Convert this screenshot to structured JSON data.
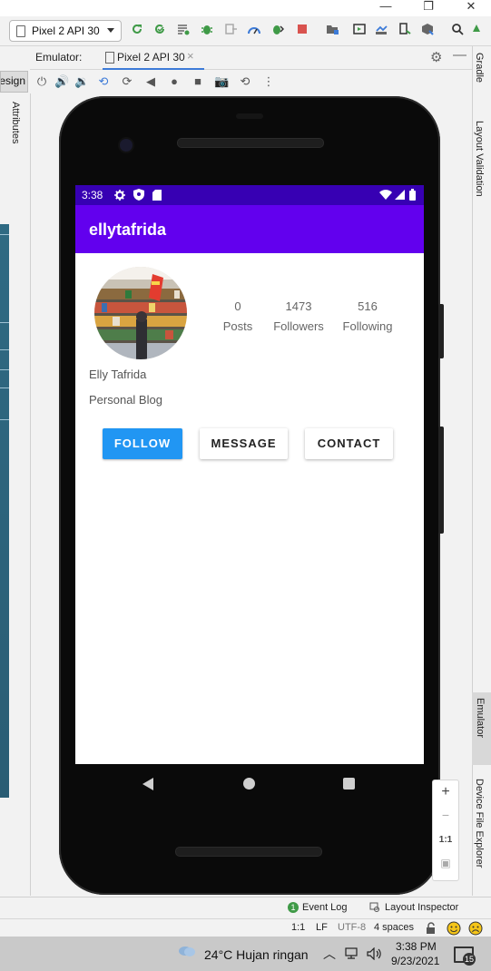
{
  "toolbar": {
    "device_label": "Pixel 2 API 30"
  },
  "emulator_panel": {
    "label": "Emulator:",
    "tab_label": "Pixel 2 API 30"
  },
  "left_panel": {
    "design_tab": "esign",
    "attributes_tab": "Attributes"
  },
  "right_panel": {
    "gradle": "Gradle",
    "layout_validation": "Layout Validation",
    "emulator": "Emulator",
    "device_file_explorer": "Device File Explorer"
  },
  "phone": {
    "status_time": "3:38",
    "app_title": "ellytafrida",
    "stats": [
      {
        "value": "0",
        "label": "Posts"
      },
      {
        "value": "1473",
        "label": "Followers"
      },
      {
        "value": "516",
        "label": "Following"
      }
    ],
    "profile_name": "Elly Tafrida",
    "profile_bio": "Personal Blog",
    "buttons": {
      "follow": "FOLLOW",
      "message": "MESSAGE",
      "contact": "CONTACT"
    }
  },
  "zoom": {
    "plus": "+",
    "minus": "−",
    "one_to_one": "1:1"
  },
  "tool_windows": {
    "event_log": "Event Log",
    "event_log_count": "1",
    "layout_inspector": "Layout Inspector"
  },
  "ide_status": {
    "position": "1:1",
    "line_sep": "LF",
    "encoding": "UTF-8",
    "indent": "4 spaces"
  },
  "taskbar": {
    "weather": "24°C  Hujan ringan",
    "time": "3:38 PM",
    "date": "9/23/2021",
    "notification_count": "15"
  },
  "colors": {
    "status_bar": "#3700b3",
    "app_bar": "#6200ee",
    "follow_button": "#2196f3"
  }
}
